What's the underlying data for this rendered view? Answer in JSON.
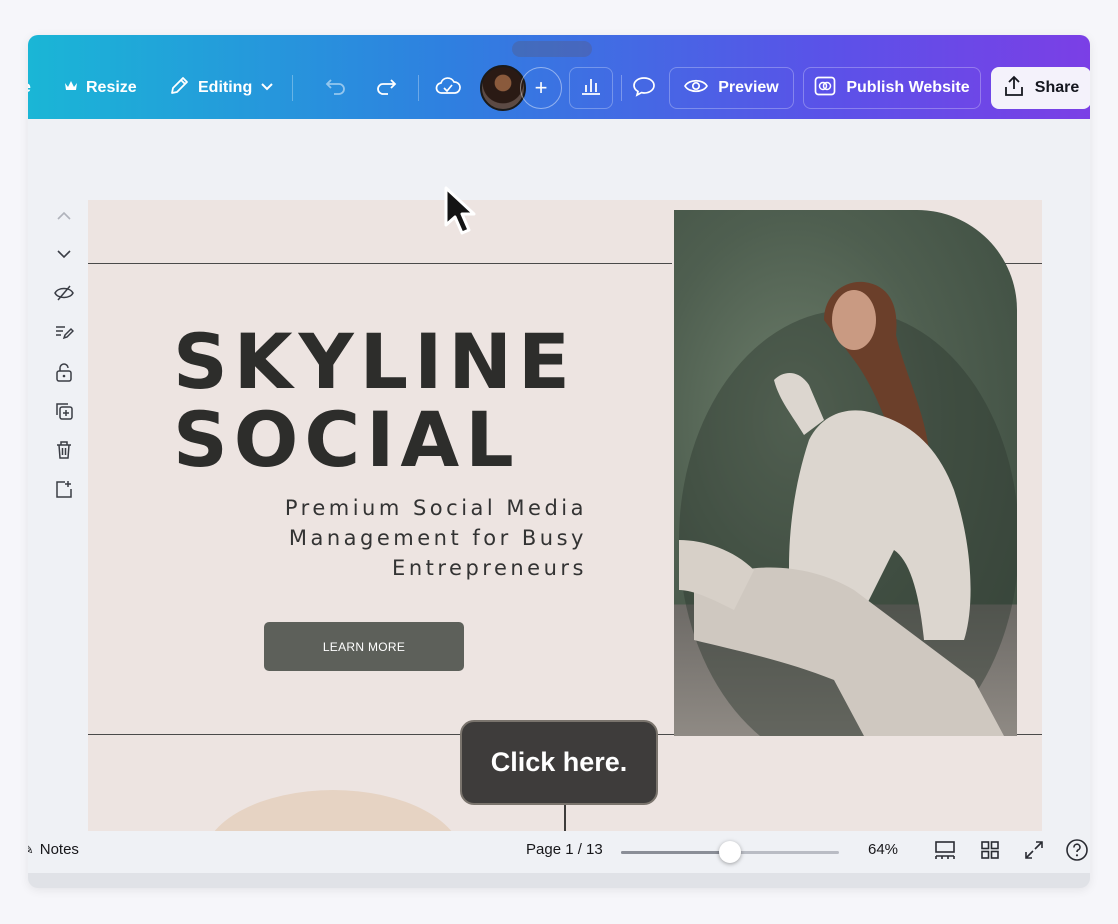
{
  "toolbar": {
    "resize_label": "Resize",
    "editing_label": "Editing",
    "preview_label": "Preview",
    "publish_label": "Publish Website",
    "share_label": "Share"
  },
  "canvas": {
    "headline_line1": "SKYLINE",
    "headline_line2": "SOCIAL",
    "subline_line1": "Premium Social Media",
    "subline_line2": "Management for Busy",
    "subline_line3": "Entrepreneurs",
    "button_label": "LEARN MORE"
  },
  "tooltip": {
    "text": "Click here."
  },
  "bottom_bar": {
    "notes_label": "Notes",
    "page_indicator": "Page 1 / 13",
    "zoom_label": "64%",
    "zoom_fraction": 0.5
  },
  "colors": {
    "toolbar_gradient_start": "#1ab6d6",
    "toolbar_gradient_end": "#7b3fe6",
    "page_background": "#ede4e1",
    "button_background": "#5d605a"
  },
  "icons": {
    "toolbar": [
      "crown-icon",
      "pencil-icon",
      "chevron-down-icon",
      "undo-icon",
      "redo-icon",
      "cloud-check-icon",
      "plus-icon",
      "bar-chart-icon",
      "comment-icon",
      "eye-icon",
      "publish-icon",
      "share-upload-icon"
    ],
    "side": [
      "chevron-up-icon",
      "chevron-down-icon",
      "eye-hide-icon",
      "notes-edit-icon",
      "lock-icon",
      "duplicate-icon",
      "trash-icon",
      "add-page-icon"
    ],
    "bottom": [
      "notes-icon",
      "thumbnail-view-icon",
      "grid-view-icon",
      "fullscreen-icon",
      "help-icon"
    ]
  }
}
